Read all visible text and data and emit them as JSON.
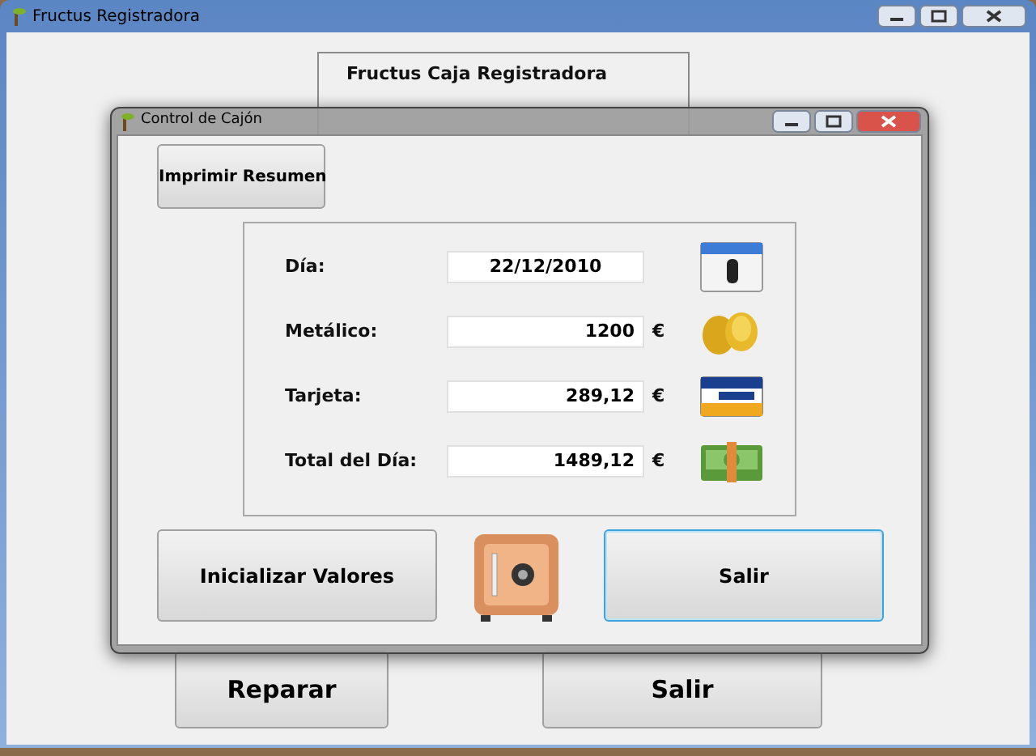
{
  "main_window": {
    "title": "Fructus Registradora",
    "heading": "Fructus Caja Registradora",
    "buttons": [
      {
        "label": "Reparar"
      },
      {
        "label": "Salir"
      }
    ]
  },
  "dialog": {
    "title": "Control de Cajón",
    "print_button": "Imprimir Resumen",
    "fields": [
      {
        "kind": "date",
        "label": "Día:",
        "value": "22/12/2010"
      },
      {
        "kind": "amount",
        "label": "Metálico:",
        "value": "1200",
        "currency": "€"
      },
      {
        "kind": "amount",
        "label": "Tarjeta:",
        "value": "289,12",
        "currency": "€"
      },
      {
        "kind": "amount",
        "label": "Total del Día:",
        "value": "1489,12",
        "currency": "€"
      }
    ],
    "buttons": [
      {
        "label": "Inicializar Valores",
        "focused": false
      },
      {
        "label": "Salir",
        "focused": true
      }
    ]
  }
}
